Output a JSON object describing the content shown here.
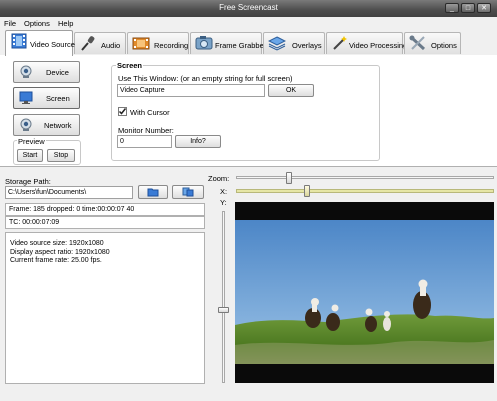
{
  "window": {
    "title": "Free Screencast"
  },
  "menu": [
    {
      "label": "File"
    },
    {
      "label": "Options"
    },
    {
      "label": "Help"
    }
  ],
  "tabs": [
    {
      "label": "Video Source",
      "icon": "film-icon"
    },
    {
      "label": "Audio",
      "icon": "microphone-icon"
    },
    {
      "label": "Recording",
      "icon": "film-reel-icon"
    },
    {
      "label": "Frame Grabber",
      "icon": "camera-icon"
    },
    {
      "label": "Overlays",
      "icon": "layers-icon"
    },
    {
      "label": "Video Processing",
      "icon": "magic-wand-icon"
    },
    {
      "label": "Options",
      "icon": "tools-icon"
    }
  ],
  "source": {
    "device_label": "Device",
    "screen_label": "Screen",
    "network_label": "Network",
    "preview_label": "Preview",
    "start_label": "Start",
    "stop_label": "Stop"
  },
  "screen_group": {
    "title": "Screen",
    "use_window_label": "Use This Window:  (or an empty string for full screen)",
    "window_value": "Video Capture",
    "ok_label": "OK",
    "with_cursor_label": "With Cursor",
    "with_cursor_checked": true,
    "monitor_label": "Monitor Number:",
    "monitor_value": "0",
    "info_label": "Info?"
  },
  "storage": {
    "label": "Storage Path:",
    "path": "C:\\Users\\fun\\Documents\\"
  },
  "stats": {
    "frame": "Frame: 185 dropped: 0 time:00:00:07 40",
    "tc": "TC: 00:00:07:09",
    "source_size": "Video source size:  1920x1080",
    "aspect_ratio": "Display aspect ratio:  1920x1080",
    "frame_rate": "Current frame rate: 25.00 fps."
  },
  "preview": {
    "zoom_label": "Zoom:",
    "x_label": "X:",
    "y_label": "Y:",
    "zoom_level": 0.2,
    "x_level": 0.27,
    "y_level": 0.58
  },
  "colors": {
    "accent": "#e6e6a6",
    "titlebar": "#4d4d4d"
  }
}
